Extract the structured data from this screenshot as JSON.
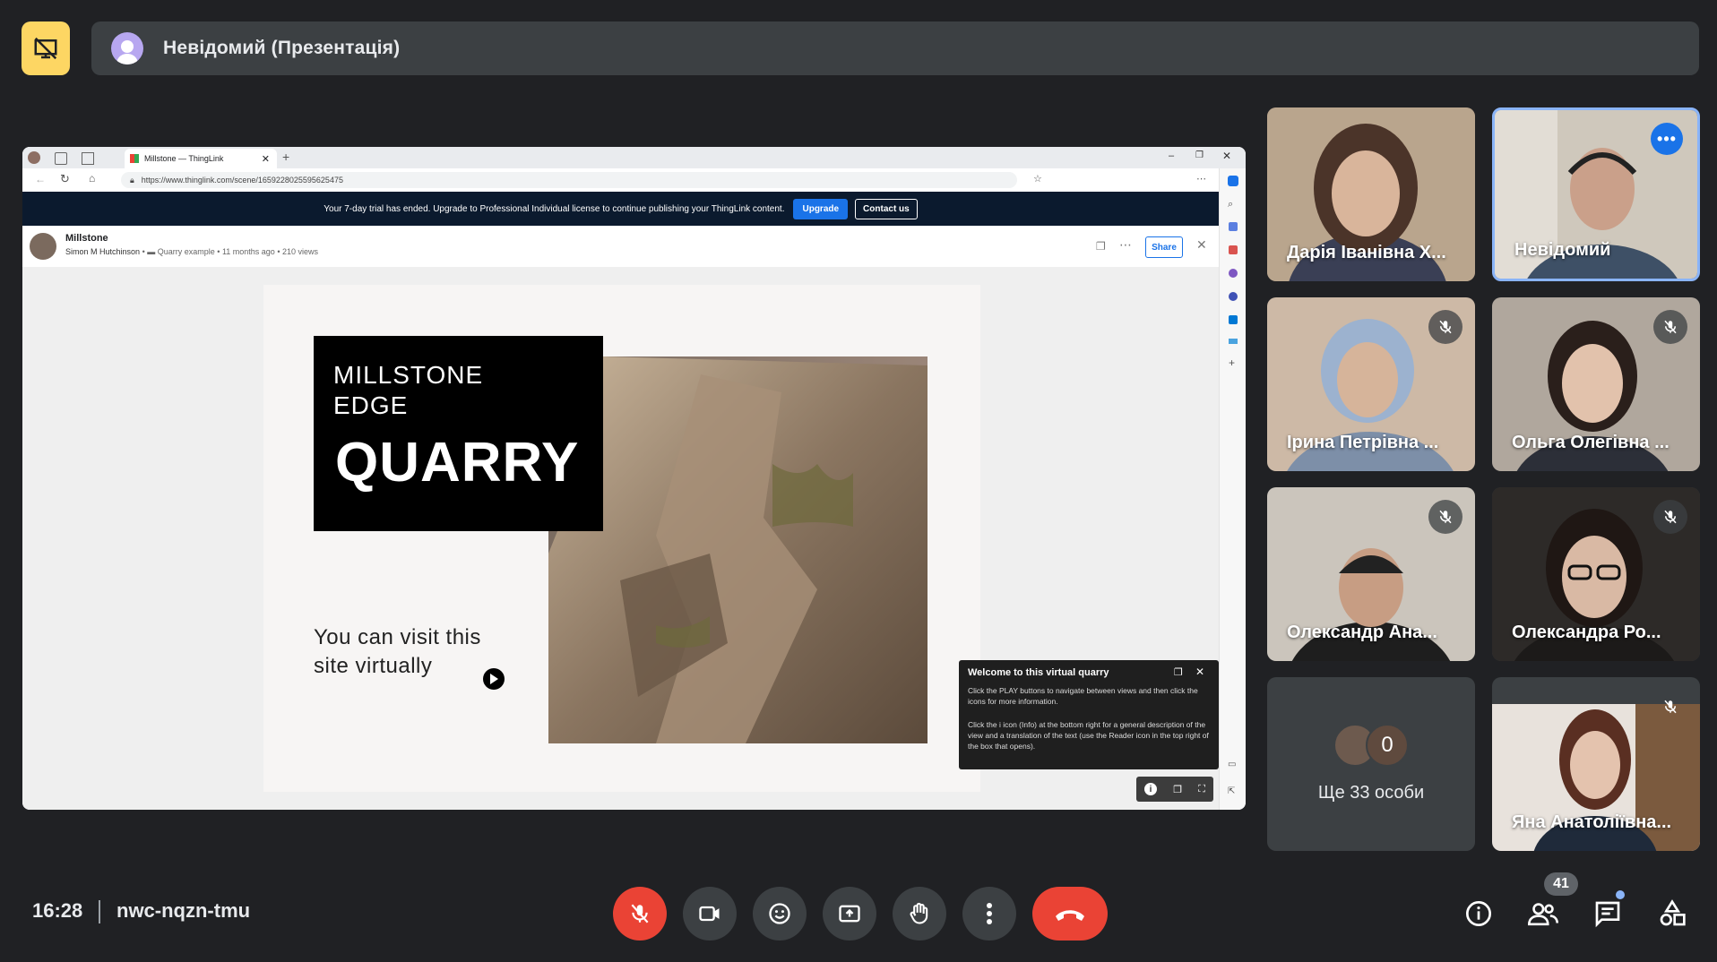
{
  "top_bar": {
    "presentation_icon": "presentation-off-icon",
    "banner_title": "Невідомий (Презентація)"
  },
  "shared_screen": {
    "browser": {
      "tab_title": "Millstone — ThingLink",
      "url": "https://www.thinglink.com/scene/1659228025595625475"
    },
    "trial_banner": {
      "message": "Your 7-day trial has ended. Upgrade to Professional Individual license to continue publishing your ThingLink content.",
      "upgrade_label": "Upgrade",
      "contact_label": "Contact us"
    },
    "scene": {
      "title": "Millstone",
      "author": "Simon M Hutchinson",
      "folder": "Quarry example",
      "age": "11 months ago",
      "views": "210 views",
      "share_label": "Share"
    },
    "slide": {
      "title_line1": "MILLSTONE",
      "title_line2": "EDGE",
      "title_big": "QUARRY",
      "caption_line1": "You can visit this",
      "caption_line2": "site virtually"
    },
    "welcome_panel": {
      "title": "Welcome to this virtual quarry",
      "para1": "Click the PLAY buttons to navigate between views and then click the icons for more information.",
      "para2": "Click the i icon (Info) at the bottom right for a general description of the view and a translation of the text (use the Reader icon in the top right of the box that opens)."
    }
  },
  "participants": [
    {
      "name": "Дарія Іванівна Х...",
      "muted": false
    },
    {
      "name": "Невідомий",
      "muted": false,
      "active": true
    },
    {
      "name": "Ірина Петрівна ...",
      "muted": true
    },
    {
      "name": "Ольга Олегівна ...",
      "muted": true
    },
    {
      "name": "Олександр Ана...",
      "muted": true
    },
    {
      "name": "Олександра Ро...",
      "muted": true
    },
    {
      "name": "Ще 33 особи",
      "count_badge": "0"
    },
    {
      "name": "Яна Анатоліївна...",
      "muted": true
    }
  ],
  "bottom_bar": {
    "time": "16:28",
    "meeting_code": "nwc-nqzn-tmu",
    "participants_count": "41",
    "controls": [
      "mic-off-icon",
      "camera-icon",
      "emoji-icon",
      "present-screen-icon",
      "raise-hand-icon",
      "more-options-icon",
      "end-call-icon"
    ],
    "right_icons": [
      "info-icon",
      "people-icon",
      "chat-icon",
      "activities-icon"
    ],
    "colors": {
      "danger": "#ea4335",
      "control_bg": "#3c4043",
      "accent": "#1a73e8",
      "present": "#fdd663"
    }
  }
}
